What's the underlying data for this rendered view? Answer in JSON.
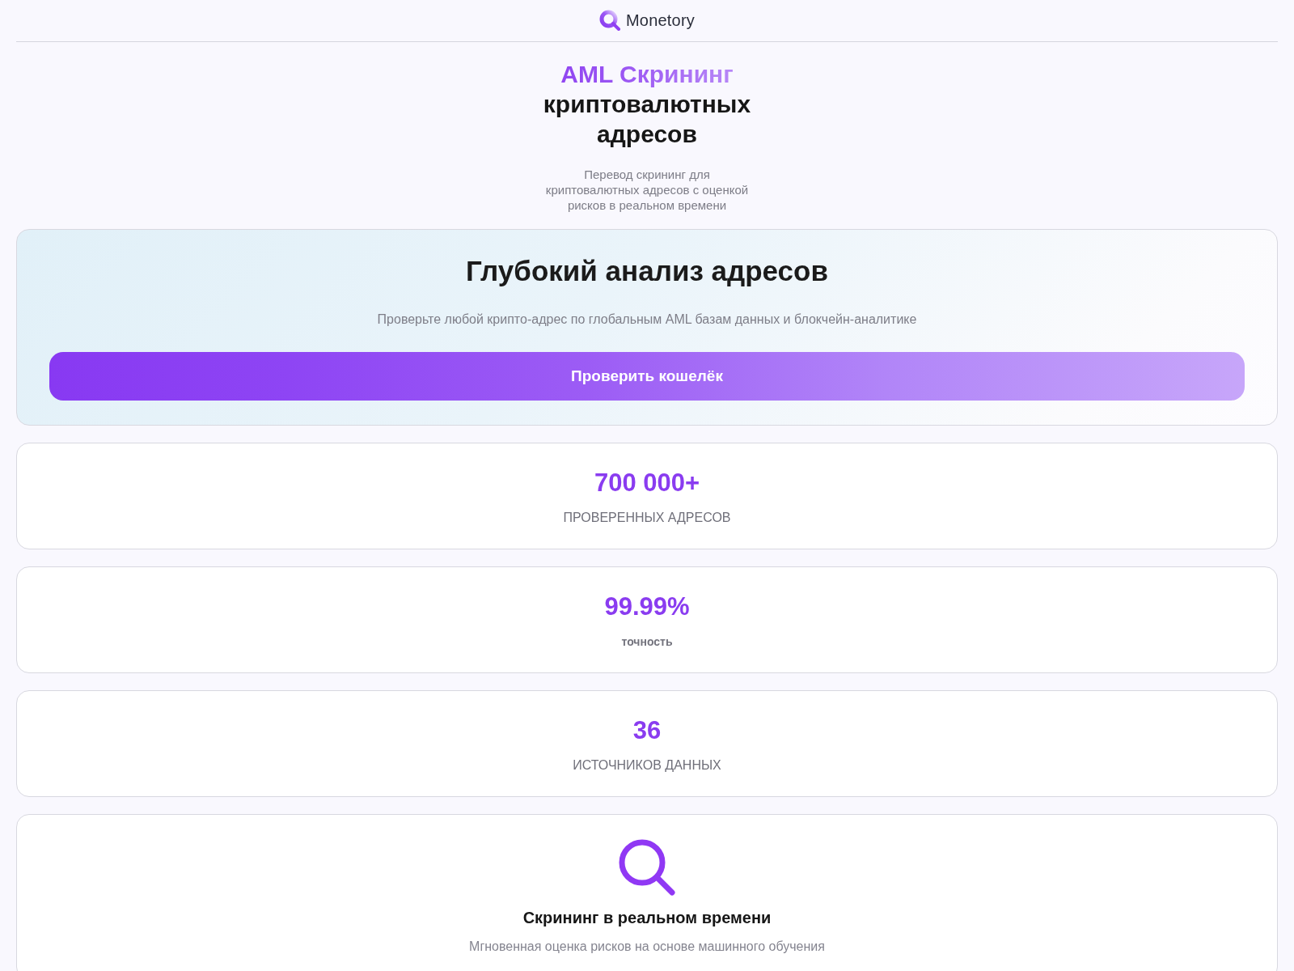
{
  "header": {
    "brand": "Monetory"
  },
  "hero": {
    "title_accent": "AML Скрининг",
    "title_rest": "криптовалютных адресов",
    "subtitle": "Перевод скрининг для криптовалютных адресов с оценкой рисков в реальном времени"
  },
  "analysis_card": {
    "title": "Глубокий анализ адресов",
    "description": "Проверьте любой крипто-адрес по глобальным AML базам данных и блокчейн-аналитике",
    "button": "Проверить кошелёк"
  },
  "stats": [
    {
      "value": "700 000+",
      "label": "ПРОВЕРЕННЫХ АДРЕСОВ",
      "kind": "caps"
    },
    {
      "value": "99.99%",
      "label": "точность",
      "kind": "small"
    },
    {
      "value": "36",
      "label": "ИСТОЧНИКОВ ДАННЫХ",
      "kind": "caps"
    }
  ],
  "features": [
    {
      "title": "Скрининг в реальном времени",
      "description": "Мгновенная оценка рисков на основе машинного обучения"
    }
  ]
}
